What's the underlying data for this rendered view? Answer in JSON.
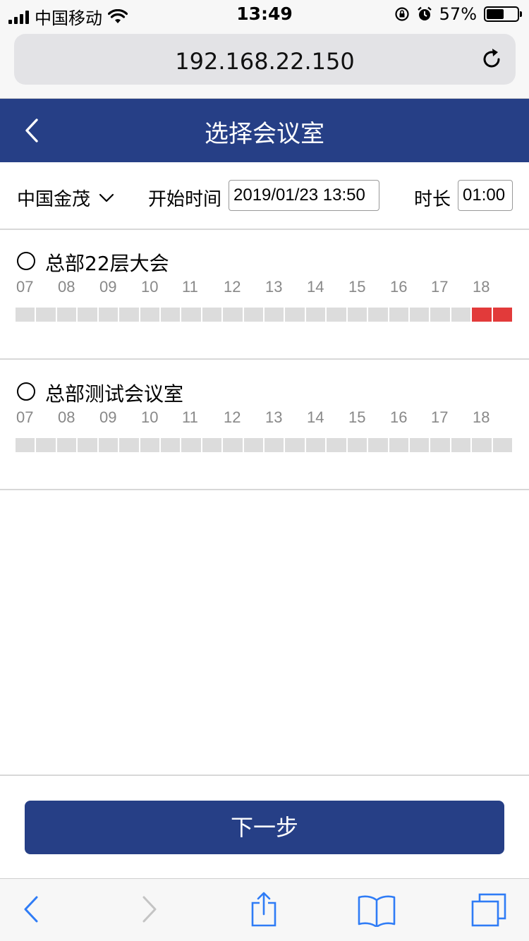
{
  "status_bar": {
    "carrier": "中国移动",
    "time": "13:49",
    "battery_percent_text": "57%",
    "battery_level": 0.57
  },
  "browser": {
    "url": "192.168.22.150"
  },
  "header": {
    "title": "选择会议室"
  },
  "filter": {
    "location": "中国金茂",
    "start_label": "开始时间",
    "start_value": "2019/01/23 13:50",
    "duration_label": "时长",
    "duration_value": "01:00"
  },
  "rooms": [
    {
      "name": "总部22层大会",
      "hours": [
        "07",
        "08",
        "09",
        "10",
        "11",
        "12",
        "13",
        "14",
        "15",
        "16",
        "17",
        "18"
      ],
      "slots_busy": [
        22,
        23
      ]
    },
    {
      "name": "总部测试会议室",
      "hours": [
        "07",
        "08",
        "09",
        "10",
        "11",
        "12",
        "13",
        "14",
        "15",
        "16",
        "17",
        "18"
      ],
      "slots_busy": []
    }
  ],
  "actions": {
    "next_label": "下一步"
  },
  "colors": {
    "brand": "#263f86",
    "busy": "#e23a3a",
    "free": "#dcdcdc",
    "safari_blue": "#2f7cf6"
  }
}
